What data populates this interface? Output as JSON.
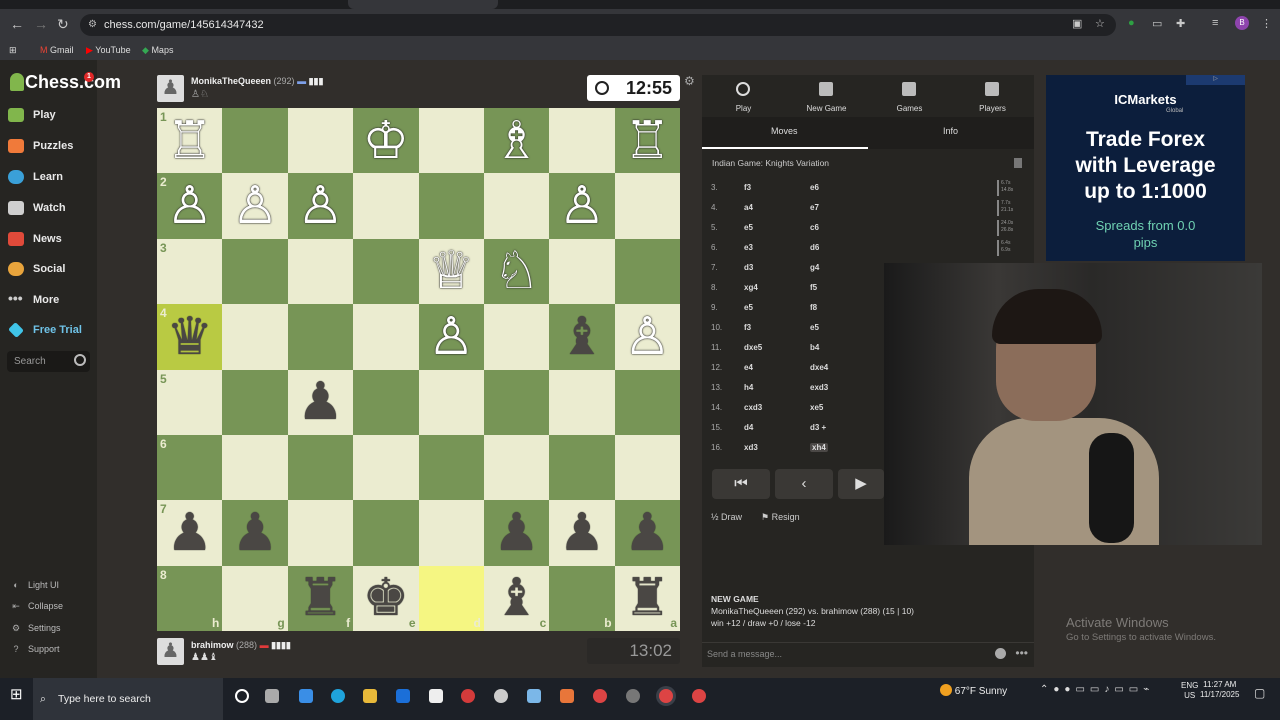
{
  "browser": {
    "url": "chess.com/game/145614347432",
    "bookmarks": [
      "Gmail",
      "YouTube",
      "Maps"
    ]
  },
  "sidebar": {
    "logo": "Chess.com",
    "badge": "1",
    "items": [
      {
        "label": "Play",
        "color": "#81b64c"
      },
      {
        "label": "Puzzles",
        "color": "#f07a3a"
      },
      {
        "label": "Learn",
        "color": "#3aa0d8"
      },
      {
        "label": "Watch",
        "color": "#cfcfcf"
      },
      {
        "label": "News",
        "color": "#e04a3a"
      },
      {
        "label": "Social",
        "color": "#e8a43c"
      },
      {
        "label": "More",
        "color": "#cfcfcf"
      }
    ],
    "free_trial": "Free Trial",
    "search_placeholder": "Search",
    "footer": [
      "Light UI",
      "Collapse",
      "Settings",
      "Support"
    ]
  },
  "top_player": {
    "name": "MonikaTheQueeen",
    "rating": "(292)",
    "clock": "12:55"
  },
  "bottom_player": {
    "name": "brahimow",
    "rating": "(288)",
    "clock": "13:02"
  },
  "board": {
    "ranks": [
      "1",
      "2",
      "3",
      "4",
      "5",
      "6",
      "7",
      "8"
    ],
    "files": [
      "h",
      "g",
      "f",
      "e",
      "d",
      "c",
      "b",
      "a"
    ],
    "pieces": [
      [
        "♖",
        "",
        "",
        "♔",
        "",
        "♗",
        "",
        "♖"
      ],
      [
        "♙",
        "♙",
        "♙",
        "",
        "",
        "",
        "♙",
        ""
      ],
      [
        "",
        "",
        "",
        "",
        "♕",
        "♘",
        "",
        ""
      ],
      [
        "♛",
        "",
        "",
        "",
        "♙",
        "",
        "♝",
        "♙"
      ],
      [
        "",
        "",
        "♟",
        "",
        "",
        "",
        "",
        ""
      ],
      [
        "",
        "",
        "",
        "",
        "",
        "",
        "",
        ""
      ],
      [
        "♟",
        "♟",
        "",
        "",
        "",
        "♟",
        "♟",
        "♟"
      ],
      [
        "",
        "",
        "♜",
        "♚",
        "",
        "♝",
        "",
        "♜"
      ]
    ]
  },
  "panel": {
    "tabs": [
      "Play",
      "New Game",
      "Games",
      "Players"
    ],
    "subtabs": [
      "Moves",
      "Info"
    ],
    "opening": "Indian Game: Knights Variation",
    "moves": [
      {
        "n": "3.",
        "w": "f3",
        "b": "e6"
      },
      {
        "n": "4.",
        "w": "a4",
        "b": "e7"
      },
      {
        "n": "5.",
        "w": "e5",
        "b": "c6"
      },
      {
        "n": "6.",
        "w": "e3",
        "b": "d6"
      },
      {
        "n": "7.",
        "w": "d3",
        "b": "g4"
      },
      {
        "n": "8.",
        "w": "xg4",
        "b": "f5"
      },
      {
        "n": "9.",
        "w": "e5",
        "b": "f8"
      },
      {
        "n": "10.",
        "w": "f3",
        "b": "e5"
      },
      {
        "n": "11.",
        "w": "dxe5",
        "b": "b4"
      },
      {
        "n": "12.",
        "w": "e4",
        "b": "dxe4"
      },
      {
        "n": "13.",
        "w": "h4",
        "b": "exd3"
      },
      {
        "n": "14.",
        "w": "cxd3",
        "b": "xe5"
      },
      {
        "n": "15.",
        "w": "d4",
        "b": "d3 +"
      },
      {
        "n": "16.",
        "w": "xd3",
        "b": "xh4"
      }
    ],
    "times": [
      "6.7s",
      "14.8s",
      "7.7s",
      "21.1s",
      "24.0s",
      "26.8s",
      "6.4s",
      "6.9s"
    ],
    "draw": "Draw",
    "resign": "Resign",
    "new_game_title": "NEW GAME",
    "new_game_line1": "MonikaTheQueeen (292) vs. brahimow (288) (15 | 10)",
    "new_game_line2": "win +12 / draw +0 / lose -12",
    "message_placeholder": "Send a message..."
  },
  "ad": {
    "brand": "ICMarkets",
    "brand_sub": "Global",
    "headline": "Trade Forex with Leverage up to 1:1000",
    "sub": "Spreads from 0.0 pips"
  },
  "watermark": {
    "title": "Activate Windows",
    "sub": "Go to Settings to activate Windows."
  },
  "taskbar": {
    "search": "Type here to search",
    "temp": "67°F",
    "weather": "Sunny",
    "lang1": "ENG",
    "lang2": "US",
    "time": "11:27 AM",
    "date": "11/17/2025"
  }
}
